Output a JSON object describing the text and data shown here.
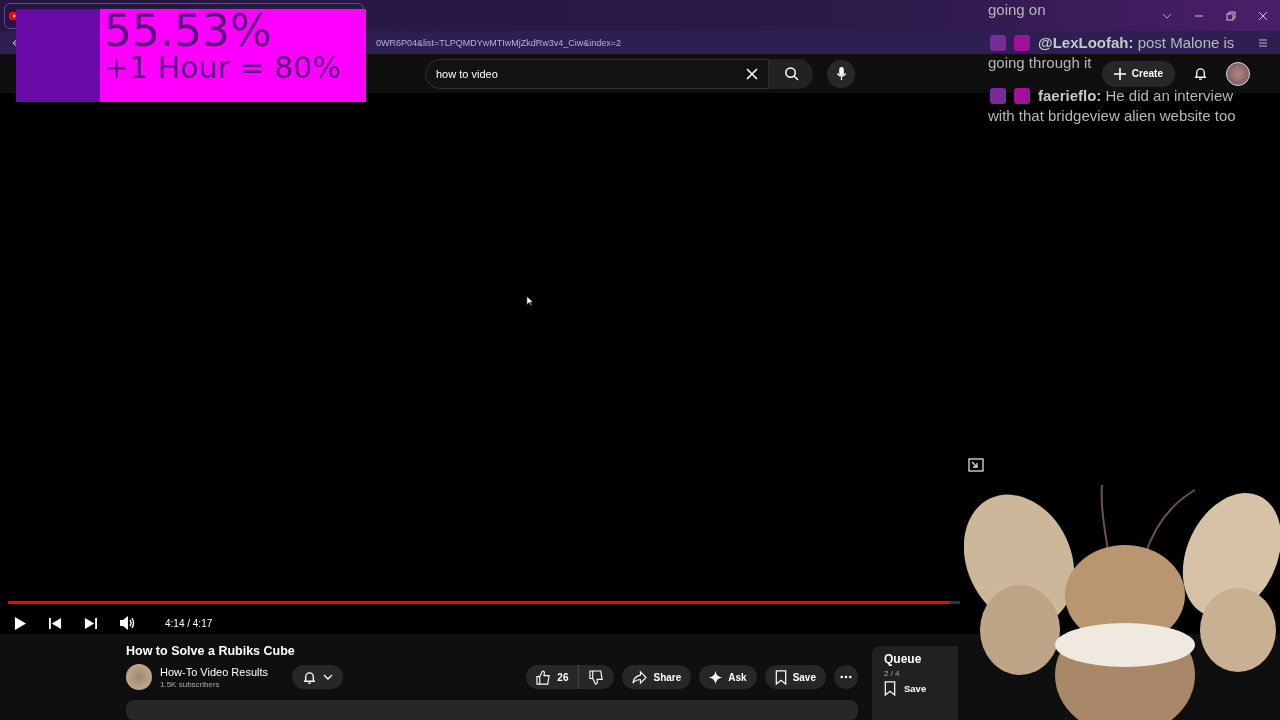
{
  "browser": {
    "address": "0WR6P04&list=TLPQMDYwMTIwMjZkdRw3v4_Ciw&index=2"
  },
  "overlay": {
    "goal_percent": "55.53%",
    "goal_note": "+1 Hour = 80%"
  },
  "chat": [
    {
      "kind": "continued",
      "text": "going on"
    },
    {
      "kind": "message",
      "user": "@LexLoofah:",
      "text": "post Malone is going through it"
    },
    {
      "kind": "message",
      "user": "faerieflo:",
      "text": "He did an interview with that bridgeview alien website too"
    }
  ],
  "header": {
    "search": {
      "value": "how to video"
    },
    "create": "Create"
  },
  "player": {
    "level": 0.99,
    "time": "4:14 / 4:17"
  },
  "video": {
    "title": "How to Solve a Rubiks Cube",
    "channel": "How-To Video Results",
    "subscribers": "1.5K subscribers",
    "likes": "26",
    "actions": [
      {
        "kind": "share",
        "label": "Share"
      },
      {
        "kind": "ask",
        "label": "Ask"
      },
      {
        "kind": "save",
        "label": "Save"
      }
    ]
  },
  "queue": {
    "title": "Queue",
    "position": "2 / 4",
    "save": "Save"
  }
}
